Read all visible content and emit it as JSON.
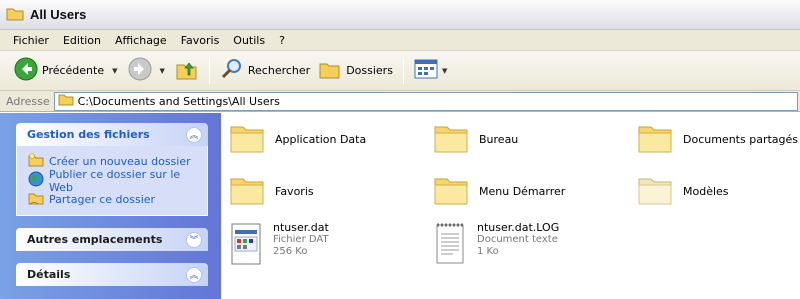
{
  "window": {
    "title": "All Users"
  },
  "menubar": {
    "items": [
      "Fichier",
      "Edition",
      "Affichage",
      "Favoris",
      "Outils",
      "?"
    ]
  },
  "toolbar": {
    "back_label": "Précédente",
    "search_label": "Rechercher",
    "folders_label": "Dossiers"
  },
  "address": {
    "label": "Adresse",
    "value": "C:\\Documents and Settings\\All Users"
  },
  "sidepane": {
    "file_tasks": {
      "title": "Gestion des fichiers",
      "tasks": [
        "Créer un nouveau dossier",
        "Publier ce dossier sur le Web",
        "Partager ce dossier"
      ]
    },
    "other_places": {
      "title": "Autres emplacements"
    },
    "details": {
      "title": "Détails"
    }
  },
  "content": {
    "folders": [
      "Application Data",
      "Bureau",
      "Documents partagés",
      "Favoris",
      "Menu Démarrer",
      "Modèles"
    ],
    "files": [
      {
        "name": "ntuser.dat",
        "type": "Fichier DAT",
        "size": "256 Ko"
      },
      {
        "name": "ntuser.dat.LOG",
        "type": "Document texte",
        "size": "1 Ko"
      }
    ]
  },
  "colors": {
    "task_link": "#215dc6",
    "sidepane_gradient_start": "#7aa1e6",
    "sidepane_gradient_end": "#6375d6",
    "folder": "#f6d56a"
  }
}
